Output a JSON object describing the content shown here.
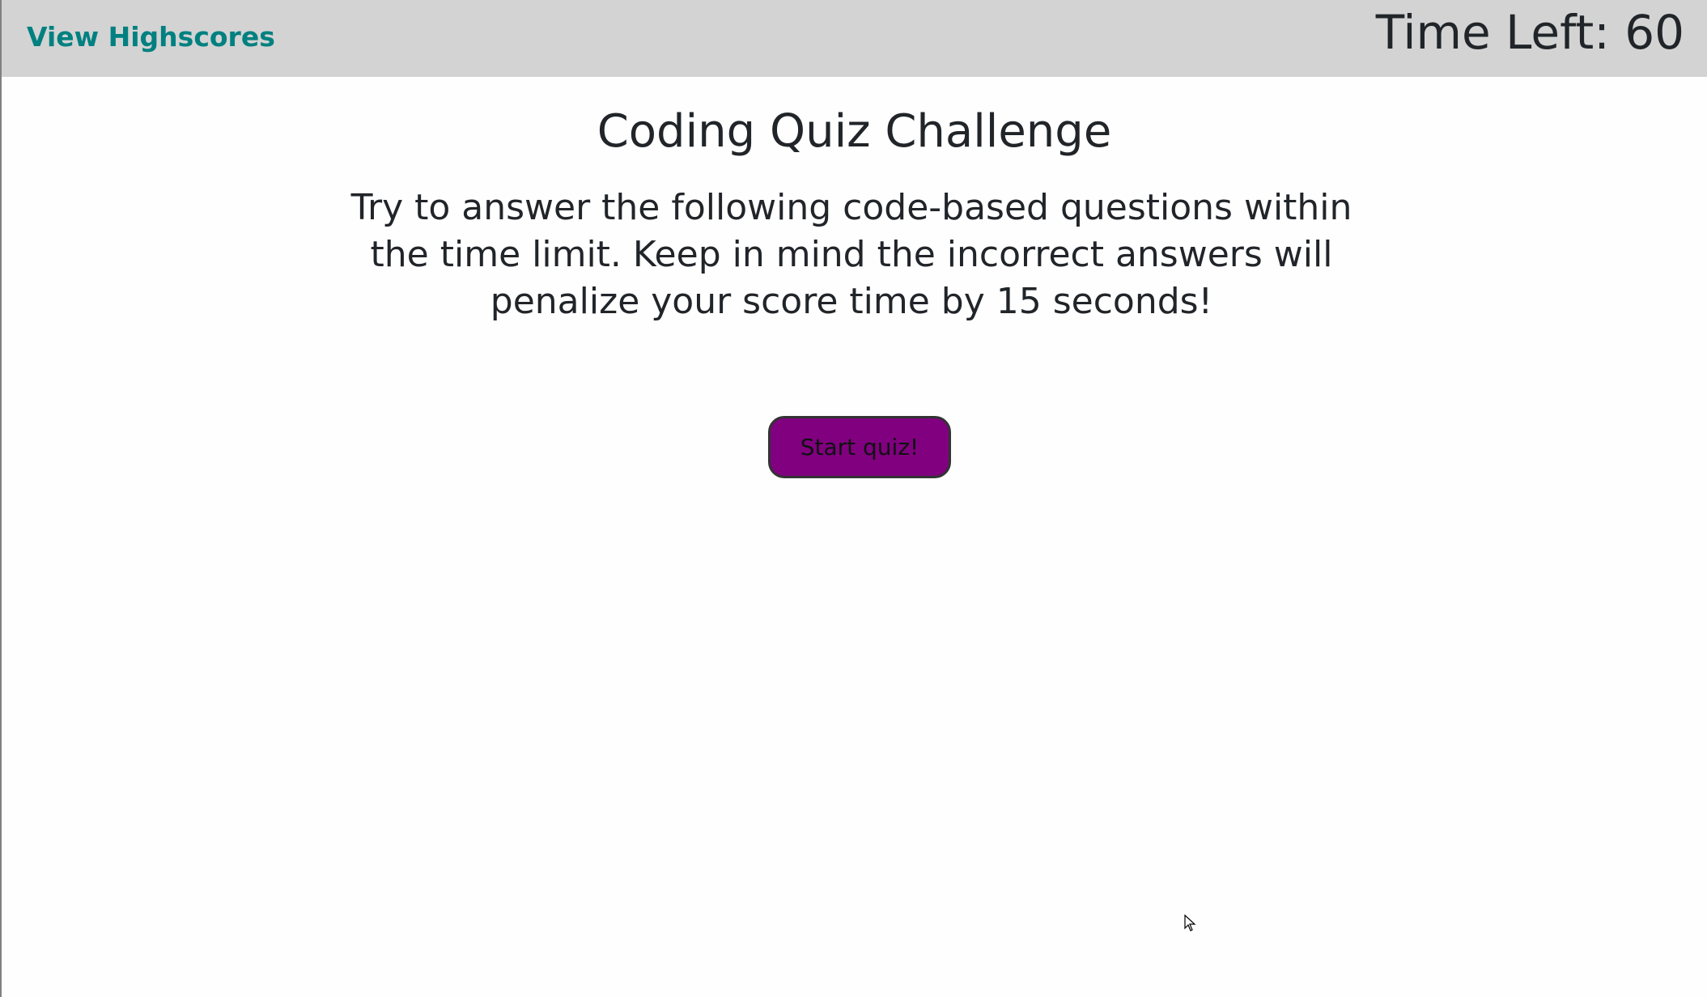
{
  "header": {
    "highscores_link": "View Highscores",
    "timer_label": "Time Left: 60"
  },
  "main": {
    "title": "Coding Quiz Challenge",
    "description": "Try to answer the following code-based questions within the time limit. Keep in mind the incorrect answers will penalize your score time by 15 seconds!",
    "start_button": "Start quiz!"
  },
  "colors": {
    "header_bg": "#d3d3d3",
    "link": "#008080",
    "button": "#800080"
  }
}
